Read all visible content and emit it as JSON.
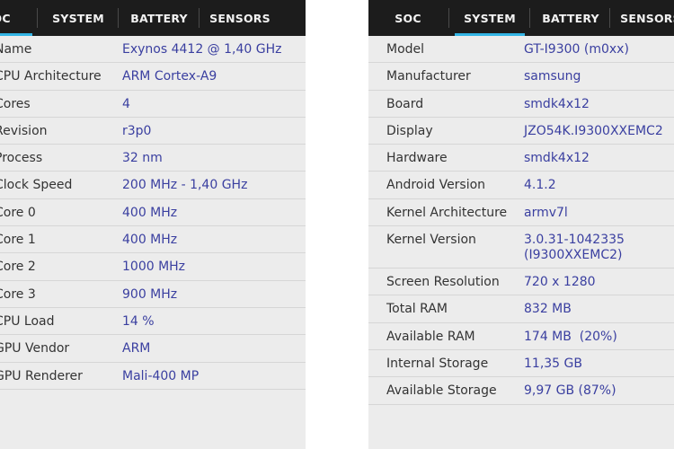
{
  "left": {
    "tabs": [
      "SOC",
      "SYSTEM",
      "BATTERY",
      "SENSORS"
    ],
    "active_tab": "SOC",
    "rows": [
      {
        "label": "Name",
        "value": "Exynos 4412 @ 1,40 GHz"
      },
      {
        "label": "CPU Architecture",
        "value": "ARM Cortex-A9"
      },
      {
        "label": "Cores",
        "value": "4"
      },
      {
        "label": "Revision",
        "value": "r3p0"
      },
      {
        "label": "Process",
        "value": "32 nm"
      },
      {
        "label": "Clock Speed",
        "value": "200 MHz - 1,40 GHz"
      },
      {
        "label": "  Core 0",
        "value": "400 MHz"
      },
      {
        "label": "  Core 1",
        "value": "400 MHz"
      },
      {
        "label": "  Core 2",
        "value": "1000 MHz"
      },
      {
        "label": "  Core 3",
        "value": "900 MHz"
      },
      {
        "label": "CPU Load",
        "value": "14 %"
      },
      {
        "label": "GPU Vendor",
        "value": "ARM"
      },
      {
        "label": "GPU Renderer",
        "value": "Mali-400 MP"
      }
    ]
  },
  "right": {
    "tabs": [
      "SOC",
      "SYSTEM",
      "BATTERY",
      "SENSORS"
    ],
    "active_tab": "SYSTEM",
    "rows": [
      {
        "label": "Model",
        "value": "GT-I9300 (m0xx)"
      },
      {
        "label": "Manufacturer",
        "value": "samsung"
      },
      {
        "label": "Board",
        "value": "smdk4x12"
      },
      {
        "label": "Display",
        "value": "JZO54K.I9300XXEMC2"
      },
      {
        "label": "Hardware",
        "value": "smdk4x12"
      },
      {
        "label": "Android Version",
        "value": "4.1.2"
      },
      {
        "label": "Kernel Architecture",
        "value": "armv7l"
      },
      {
        "label": "Kernel Version",
        "value": "3.0.31-1042335\n(I9300XXEMC2)"
      },
      {
        "label": "Screen Resolution",
        "value": "720 x 1280"
      },
      {
        "label": "Total RAM",
        "value": "832 MB"
      },
      {
        "label": "Available RAM",
        "value": "174 MB  (20%)"
      },
      {
        "label": "Internal Storage",
        "value": "11,35 GB"
      },
      {
        "label": "Available Storage",
        "value": "9,97 GB (87%)"
      }
    ]
  },
  "colors": {
    "tab_bar": "#1c1c1c",
    "tab_indicator": "#33b5e5",
    "background": "#ececec",
    "label_text": "#333333",
    "value_text": "#3a3fa0",
    "divider": "#d6d6d6"
  }
}
